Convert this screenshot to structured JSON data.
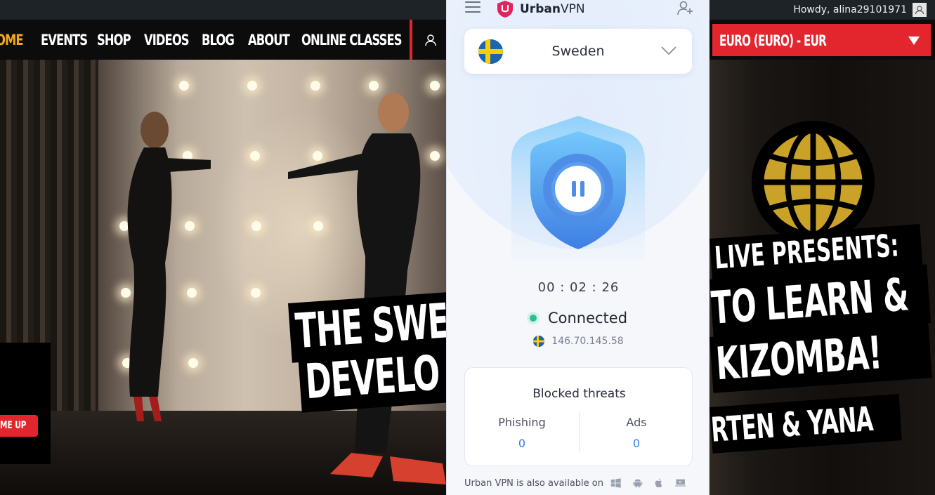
{
  "admin_bar": {
    "greeting": "Howdy, alina29101971"
  },
  "site_nav": {
    "items": [
      "OME",
      "EVENTS",
      "SHOP",
      "VIDEOS",
      "BLOG",
      "ABOUT",
      "ONLINE CLASSES"
    ],
    "active_color": "#f5a623",
    "accent": "#e3262e"
  },
  "currency": {
    "label": "EURO (EURO) - EUR"
  },
  "hero_left": {
    "headline_line1": "THE SWE",
    "headline_line2": "DEVELO",
    "cta": "ME UP"
  },
  "hero_right": {
    "line1": "LIVE PRESENTS:",
    "line2": "TO LEARN &",
    "line3": "KIZOMBA!",
    "line4": "RTEN & YANA"
  },
  "vpn": {
    "brand_bold": "Urban",
    "brand_light": "VPN",
    "country": "Sweden",
    "timer": "00 : 02 : 26",
    "status": "Connected",
    "ip": "146.70.145.58",
    "threats": {
      "title": "Blocked threats",
      "phishing_label": "Phishing",
      "phishing_value": "0",
      "ads_label": "Ads",
      "ads_value": "0"
    },
    "available_text": "Urban VPN is also available on",
    "platform_icons": [
      "windows-icon",
      "android-icon",
      "apple-icon",
      "desktop-icon"
    ],
    "colors": {
      "connected": "#23c197",
      "accent_blue": "#2f7de1",
      "brand_pink": "#e0245e"
    }
  }
}
